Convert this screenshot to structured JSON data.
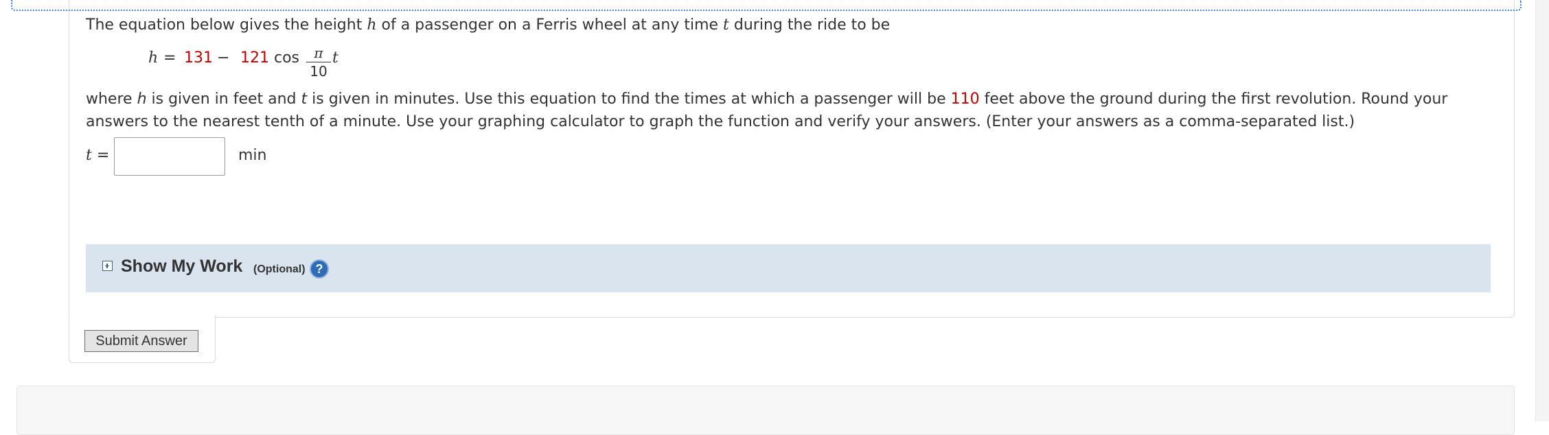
{
  "question": {
    "intro_before_h": "The equation below gives the height ",
    "var_h": "h",
    "intro_mid": " of a passenger on a Ferris wheel at any time ",
    "var_t": "t",
    "intro_after": " during the ride to be",
    "equation": {
      "lhs": "h",
      "equals": "=",
      "constant": "131",
      "minus": "−",
      "coefficient": "121",
      "func": "cos",
      "frac_num": "π",
      "frac_den": "10",
      "var": "t"
    },
    "desc_part1": "where ",
    "desc_h": "h",
    "desc_part2": " is given in feet and ",
    "desc_t": "t",
    "desc_part3": " is given in minutes. Use this equation to find the times at which a passenger will be ",
    "height_value": "110",
    "desc_part4": " feet above the ground during the first revolution. Round your answers to the nearest tenth of a minute. Use your graphing calculator to graph the function and verify your answers. (Enter your answers as a comma-separated list.)"
  },
  "answer": {
    "label_var": "t",
    "label_eq": " =",
    "value": "",
    "unit": "min"
  },
  "show_my_work": {
    "title": "Show My Work",
    "optional": "(Optional)",
    "help_glyph": "?",
    "expand_icon": "plus-square-icon",
    "help_icon": "question-circle-icon"
  },
  "submit": {
    "label": "Submit Answer"
  },
  "colors": {
    "value_red": "#c00000",
    "panel_blue": "#d9e4ef",
    "focus_blue": "#3d7fd6"
  }
}
